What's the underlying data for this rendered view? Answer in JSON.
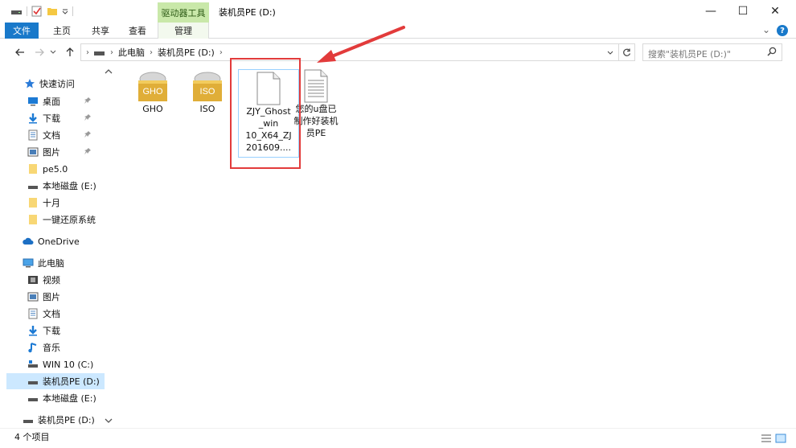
{
  "window": {
    "title": "装机员PE (D:)",
    "context_tab": "驱动器工具",
    "controls": {
      "minimize": "—",
      "maximize": "☐",
      "close": "✕"
    }
  },
  "ribbon": {
    "tabs": [
      "文件",
      "主页",
      "共享",
      "查看",
      "管理"
    ],
    "collapse": "⌄",
    "help": "?"
  },
  "address": {
    "crumbs": [
      "此电脑",
      "装机员PE (D:)"
    ],
    "search_placeholder": "搜索\"装机员PE (D:)\""
  },
  "nav": {
    "quick_access": "快速访问",
    "items": [
      {
        "label": "桌面",
        "icon": "desktop-icon",
        "pinned": true
      },
      {
        "label": "下载",
        "icon": "download-icon",
        "pinned": true
      },
      {
        "label": "文档",
        "icon": "document-icon",
        "pinned": true
      },
      {
        "label": "图片",
        "icon": "picture-icon",
        "pinned": true
      },
      {
        "label": "pe5.0",
        "icon": "folder-icon",
        "pinned": false
      },
      {
        "label": "本地磁盘 (E:)",
        "icon": "drive-icon",
        "pinned": false
      },
      {
        "label": "十月",
        "icon": "folder-icon",
        "pinned": false
      },
      {
        "label": "一键还原系统",
        "icon": "folder-icon",
        "pinned": false
      }
    ],
    "onedrive": "OneDrive",
    "this_pc": "此电脑",
    "pc_items": [
      {
        "label": "视频",
        "icon": "video-icon"
      },
      {
        "label": "图片",
        "icon": "picture-icon"
      },
      {
        "label": "文档",
        "icon": "document-icon"
      },
      {
        "label": "下载",
        "icon": "download-icon"
      },
      {
        "label": "音乐",
        "icon": "music-icon"
      },
      {
        "label": "WIN 10 (C:)",
        "icon": "system-drive-icon"
      },
      {
        "label": "装机员PE (D:)",
        "icon": "drive-icon"
      },
      {
        "label": "本地磁盘 (E:)",
        "icon": "drive-icon"
      }
    ],
    "bottom_item": "装机员PE (D:)"
  },
  "files": [
    {
      "name": "GHO",
      "type": "folder",
      "badge": "GHO"
    },
    {
      "name": "ISO",
      "type": "folder",
      "badge": "ISO"
    },
    {
      "name": "ZJY_Ghost_win10_X64_ZJ201609....",
      "type": "file"
    },
    {
      "name": "您的u盘已制作好装机员PE",
      "type": "text"
    }
  ],
  "file_name_lines": {
    "f3": [
      "ZJY_Ghost",
      "_win",
      "10_X64_ZJ",
      "201609...."
    ],
    "f4": [
      "您的u盘已",
      "制作好装机",
      "员PE"
    ]
  },
  "status": {
    "count": "4 个项目"
  },
  "colors": {
    "accent": "#1979ca",
    "context_tab": "#c9e8a9",
    "annotation": "#e23b3b",
    "selection": "#cce8ff"
  }
}
